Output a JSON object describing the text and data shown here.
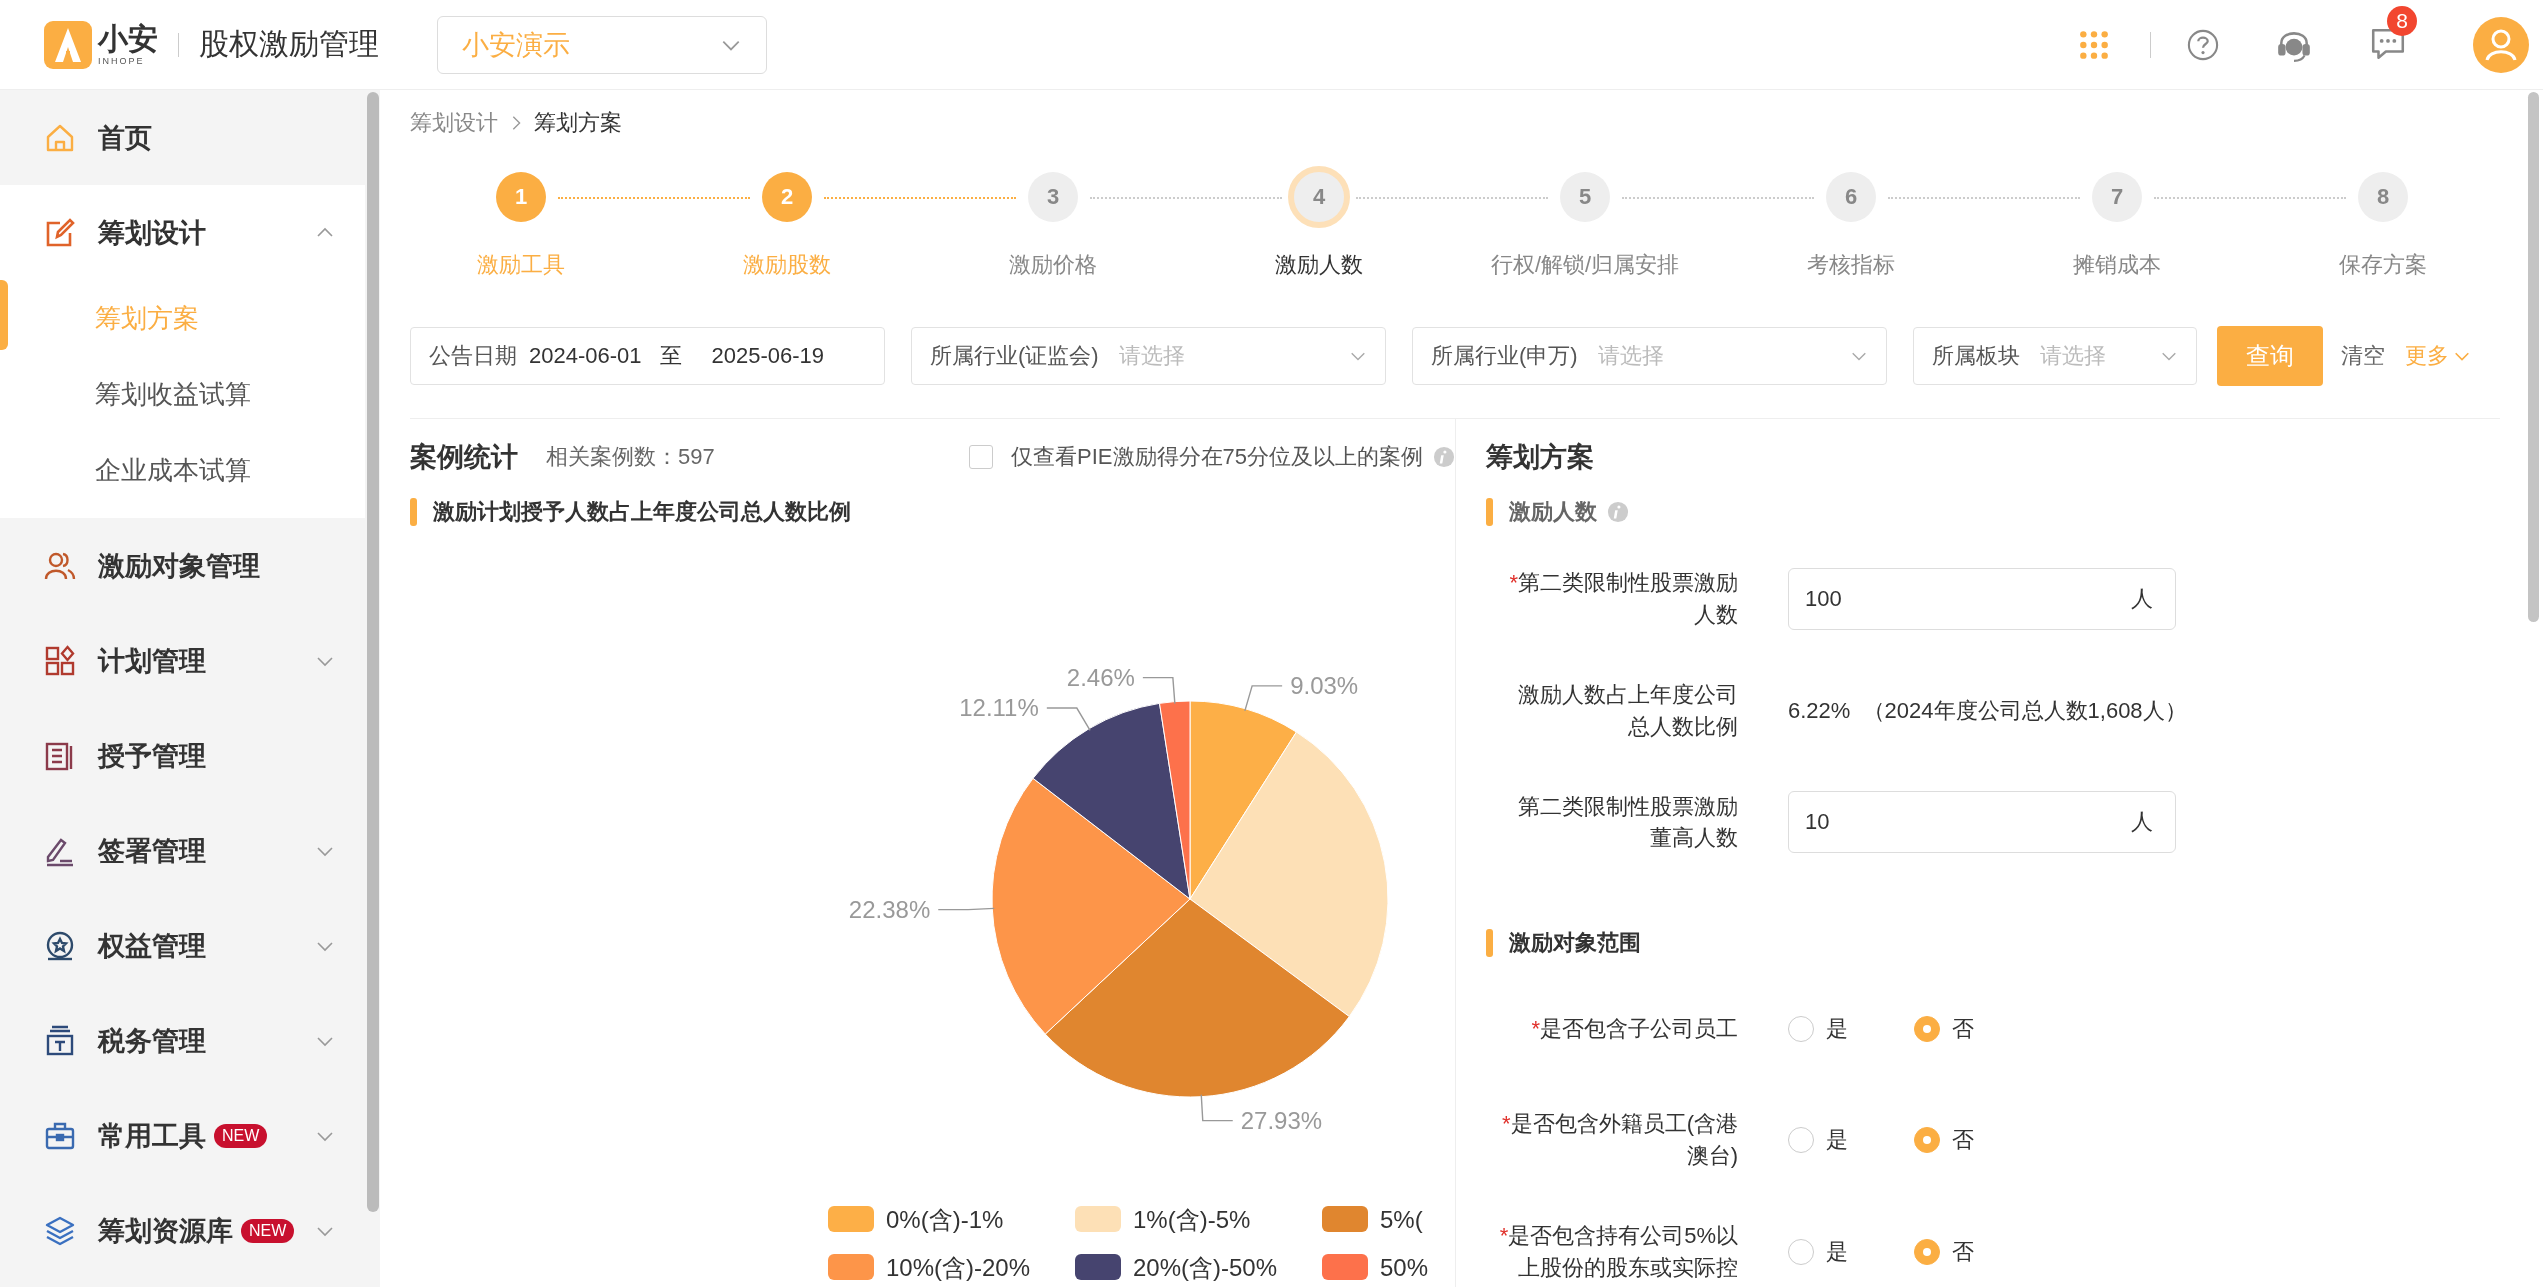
{
  "header": {
    "logo_text": "小安",
    "logo_subtext": "INHOPE",
    "app_title": "股权激励管理",
    "org_select": "小安演示",
    "message_badge": "8"
  },
  "sidebar": {
    "items": [
      {
        "label": "首页"
      },
      {
        "label": "筹划设计",
        "expanded": true,
        "children": [
          {
            "label": "筹划方案",
            "selected": true
          },
          {
            "label": "筹划收益试算",
            "selected": false
          },
          {
            "label": "企业成本试算",
            "selected": false
          }
        ]
      },
      {
        "label": "激励对象管理"
      },
      {
        "label": "计划管理",
        "expanded": false
      },
      {
        "label": "授予管理"
      },
      {
        "label": "签署管理",
        "expanded": false
      },
      {
        "label": "权益管理",
        "expanded": false
      },
      {
        "label": "税务管理",
        "expanded": false
      },
      {
        "label": "常用工具",
        "badge": "NEW",
        "expanded": false
      },
      {
        "label": "筹划资源库",
        "badge": "NEW",
        "expanded": false
      }
    ]
  },
  "breadcrumb": [
    "筹划设计",
    "筹划方案"
  ],
  "steps": [
    {
      "number": "1",
      "label": "激励工具",
      "completed": true,
      "selected": false
    },
    {
      "number": "2",
      "label": "激励股数",
      "completed": true,
      "selected": false
    },
    {
      "number": "3",
      "label": "激励价格",
      "completed": false,
      "selected": false
    },
    {
      "number": "4",
      "label": "激励人数",
      "completed": false,
      "selected": true
    },
    {
      "number": "5",
      "label": "行权/解锁/归属安排",
      "completed": false,
      "selected": false
    },
    {
      "number": "6",
      "label": "考核指标",
      "completed": false,
      "selected": false
    },
    {
      "number": "7",
      "label": "摊销成本",
      "completed": false,
      "selected": false
    },
    {
      "number": "8",
      "label": "保存方案",
      "completed": false,
      "selected": false
    }
  ],
  "filters": {
    "date": {
      "label": "公告日期",
      "from": "2024-06-01",
      "separator": "至",
      "to": "2025-06-19"
    },
    "selects": [
      {
        "label": "所属行业(证监会)",
        "placeholder": "请选择"
      },
      {
        "label": "所属行业(申万)",
        "placeholder": "请选择"
      },
      {
        "label": "所属板块",
        "placeholder": "请选择"
      }
    ],
    "query_button": "查询",
    "clear_link": "清空",
    "more_link": "更多"
  },
  "cases": {
    "title": "案例统计",
    "count": "相关案例数：597",
    "filter_checkbox": {
      "label": "仅查看PIE激励得分在75分位及以上的案例",
      "checked": false
    },
    "chart_data": {
      "type": "pie",
      "title": "激励计划授予人数占上年度公司总人数比例",
      "categories": [
        "0%(含)-1%",
        "1%(含)-5%",
        "5%(",
        "10%(含)-20%",
        "20%(含)-50%",
        "50%"
      ],
      "legend": true,
      "colors": [
        "#fdaf47",
        "#fde0b6",
        "#e0862f",
        "#fd9549",
        "#46446f",
        "#fd714b"
      ],
      "values": [
        9.03,
        26.09,
        27.93,
        22.38,
        12.11,
        2.46
      ],
      "value_labels": [
        "9.03%",
        null,
        "27.93%",
        "22.38%",
        "12.11%",
        "2.46%"
      ]
    }
  },
  "plan": {
    "title": "筹划方案",
    "sections": [
      {
        "title": "激励人数",
        "info": true,
        "rows": [
          {
            "kind": "input",
            "required_mark": "*",
            "label": "第二类限制性股票激励人数",
            "value": "100",
            "unit": "人"
          },
          {
            "kind": "text",
            "label": "激励人数占上年度公司总人数比例",
            "value": "6.22%  （2024年度公司总人数1,608人）"
          },
          {
            "kind": "input",
            "label": "第二类限制性股票激励董高人数",
            "value": "10",
            "unit": "人"
          }
        ]
      },
      {
        "title": "激励对象范围",
        "rows": [
          {
            "kind": "radio",
            "required_mark": "*",
            "label": "是否包含子公司员工",
            "options": [
              {
                "label": "是",
                "selected": false
              },
              {
                "label": "否",
                "selected": true
              }
            ]
          },
          {
            "kind": "radio",
            "required_mark": "*",
            "label": "是否包含外籍员工(含港澳台)",
            "options": [
              {
                "label": "是",
                "selected": false
              },
              {
                "label": "否",
                "selected": true
              }
            ]
          },
          {
            "kind": "radio",
            "required_mark": "*",
            "label": "是否包含持有公司5%以上股份的股东或实际控",
            "options": [
              {
                "label": "是",
                "selected": false
              },
              {
                "label": "否",
                "selected": true
              }
            ]
          }
        ]
      }
    ]
  }
}
